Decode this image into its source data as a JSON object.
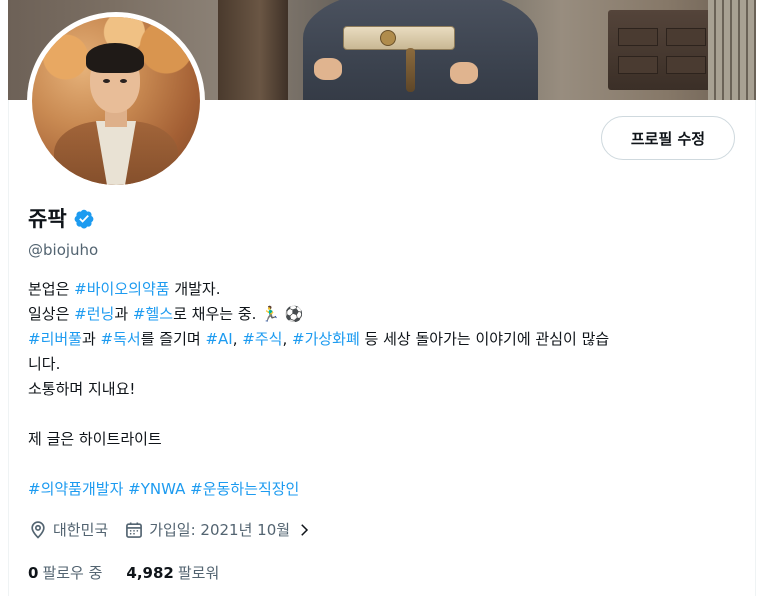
{
  "profile": {
    "name": "쥬팍",
    "handle": "@biojuho",
    "edit_label": "프로필 수정",
    "verified_color": "#1d9bf0"
  },
  "bio": {
    "l1_a": "본업은 ",
    "l1_tag": "#바이오의약품",
    "l1_b": " 개발자.",
    "l2_a": "일상은 ",
    "l2_tag1": "#런닝",
    "l2_b": "과 ",
    "l2_tag2": "#헬스",
    "l2_c": "로 채우는 중. 🏃‍♂️ ⚽",
    "l3_tag1": "#리버풀",
    "l3_a": "과 ",
    "l3_tag2": "#독서",
    "l3_b": "를 즐기며 ",
    "l3_tag3": "#AI",
    "l3_c": ", ",
    "l3_tag4": "#주식",
    "l3_d": ", ",
    "l3_tag5": "#가상화폐",
    "l3_e": " 등 세상 돌아가는 이야기에 관심이 많습",
    "l4": "니다.",
    "l5": "소통하며 지내요!",
    "l6": "제 글은 하이트라이트",
    "l7_tag1": "#의약품개발자",
    "l7_tag2": "#YNWA",
    "l7_tag3": "#운동하는직장인"
  },
  "meta": {
    "location": "대한민국",
    "joined": "가입일: 2021년 10월"
  },
  "follow": {
    "following_count": "0",
    "following_label": "팔로우 중",
    "followers_count": "4,982",
    "followers_label": "팔로워"
  },
  "colors": {
    "link": "#1d9bf0",
    "secondary_text": "#536471",
    "primary_text": "#0f1419"
  }
}
